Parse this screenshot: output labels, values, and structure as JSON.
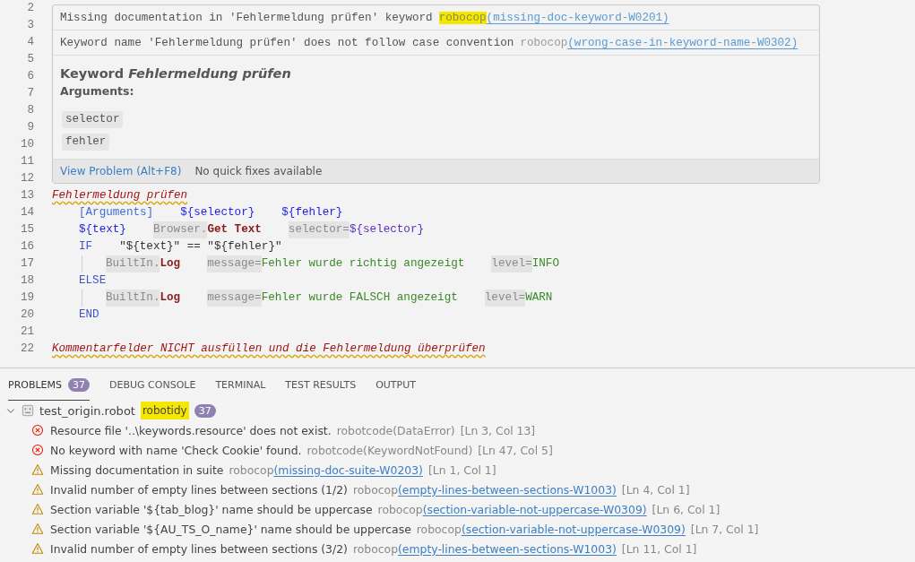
{
  "editor": {
    "lines": [
      {
        "number": "2",
        "kind": "hidden"
      },
      {
        "number": "3",
        "kind": "hidden"
      },
      {
        "number": "4",
        "kind": "hidden"
      },
      {
        "number": "5",
        "kind": "hidden"
      },
      {
        "number": "6",
        "kind": "hidden"
      },
      {
        "number": "7",
        "kind": "hidden"
      },
      {
        "number": "8",
        "kind": "hidden"
      },
      {
        "number": "9",
        "kind": "hidden"
      },
      {
        "number": "10",
        "kind": "hidden"
      },
      {
        "number": "11",
        "kind": "hidden"
      },
      {
        "number": "12",
        "kind": "hidden"
      },
      {
        "number": "13",
        "kind": "keyword",
        "tokens": [
          {
            "kind": "keyword-name",
            "text": "Fehlermeldung prüfen",
            "squiggle": true
          }
        ]
      },
      {
        "number": "14",
        "kind": "step",
        "tokens": [
          {
            "kind": "setting",
            "text": "[Arguments]"
          },
          {
            "kind": "variable",
            "text": "${selector}"
          },
          {
            "kind": "variable",
            "text": "${fehler}"
          }
        ]
      },
      {
        "number": "15",
        "kind": "step",
        "tokens": [
          {
            "kind": "variable",
            "text": "${text}"
          },
          {
            "kind": "call",
            "prefix": "Browser.",
            "text": "Get Text"
          },
          {
            "kind": "variable",
            "prefix": "selector=",
            "text": "${selector}"
          }
        ]
      },
      {
        "number": "16",
        "kind": "step",
        "tokens": [
          {
            "kind": "control",
            "text": "IF"
          },
          {
            "kind": "expression",
            "text": "\"${text}\" == \"${fehler}\""
          }
        ]
      },
      {
        "number": "17",
        "kind": "nested",
        "tokens": [
          {
            "kind": "call",
            "prefix": "BuiltIn.",
            "text": "Log"
          },
          {
            "kind": "string",
            "prefix": "message=",
            "text": "Fehler wurde richtig angezeigt"
          },
          {
            "kind": "string",
            "prefix": "level=",
            "text": "INFO"
          }
        ]
      },
      {
        "number": "18",
        "kind": "step",
        "tokens": [
          {
            "kind": "control",
            "text": "ELSE"
          }
        ]
      },
      {
        "number": "19",
        "kind": "nested",
        "tokens": [
          {
            "kind": "call",
            "prefix": "BuiltIn.",
            "text": "Log"
          },
          {
            "kind": "string",
            "prefix": "message=",
            "text": "Fehler wurde FALSCH angezeigt"
          },
          {
            "kind": "string",
            "prefix": "level=",
            "text": "WARN"
          }
        ]
      },
      {
        "number": "20",
        "kind": "step",
        "tokens": [
          {
            "kind": "control",
            "text": "END"
          }
        ]
      },
      {
        "number": "21",
        "kind": "blank"
      },
      {
        "number": "22",
        "kind": "keyword",
        "tokens": [
          {
            "kind": "keyword-name",
            "text": "Kommentarfelder NICHT ausfüllen und die Fehlermeldung überprüfen",
            "squiggle": true
          }
        ]
      }
    ],
    "hover": {
      "problems": [
        {
          "message": "Missing documentation in 'Fehlermeldung prüfen' keyword",
          "source": "robocop",
          "highlighted": true,
          "code": "(missing-doc-keyword-W0201)"
        },
        {
          "message": "Keyword name 'Fehlermeldung prüfen' does not follow case convention",
          "source": "robocop",
          "highlighted": false,
          "code": "(wrong-case-in-keyword-name-W0302)"
        }
      ],
      "doc_title": "Keyword *Fehlermeldung prüfen*",
      "arguments_label": "Arguments:",
      "arguments": [
        "selector",
        "fehler"
      ],
      "actions": [
        {
          "kind": "link",
          "text": "View Problem (Alt+F8)"
        },
        {
          "kind": "note",
          "text": "No quick fixes available"
        }
      ]
    }
  },
  "panel": {
    "tabs": [
      {
        "label": "PROBLEMS",
        "selected": true,
        "badge": "37"
      },
      {
        "label": "DEBUG CONSOLE",
        "selected": false
      },
      {
        "label": "TERMINAL",
        "selected": false
      },
      {
        "label": "TEST RESULTS",
        "selected": false
      },
      {
        "label": "OUTPUT",
        "selected": false
      }
    ],
    "file": {
      "name": "test_origin.robot",
      "expanded": true,
      "tag": "robotidy",
      "tag_highlighted": true,
      "count": "37",
      "problems": [
        {
          "kind": "error",
          "message": "Resource file '..\\keywords.resource' does not exist.",
          "source": "robotcode",
          "code": "(DataError)",
          "linked": false,
          "location": "[Ln 3, Col 13]"
        },
        {
          "kind": "error",
          "message": "No keyword with name 'Check Cookie' found.",
          "source": "robotcode",
          "code": "(KeywordNotFound)",
          "linked": false,
          "location": "[Ln 47, Col 5]"
        },
        {
          "kind": "warning",
          "message": "Missing documentation in suite",
          "source": "robocop",
          "code": "(missing-doc-suite-W0203)",
          "linked": true,
          "location": "[Ln 1, Col 1]"
        },
        {
          "kind": "warning",
          "message": "Invalid number of empty lines between sections (1/2)",
          "source": "robocop",
          "code": "(empty-lines-between-sections-W1003)",
          "linked": true,
          "location": "[Ln 4, Col 1]"
        },
        {
          "kind": "warning",
          "message": "Section variable '${tab_blog}' name should be uppercase",
          "source": "robocop",
          "code": "(section-variable-not-uppercase-W0309)",
          "linked": true,
          "location": "[Ln 6, Col 1]"
        },
        {
          "kind": "warning",
          "message": "Section variable '${AU_TS_O_name}' name should be uppercase",
          "source": "robocop",
          "code": "(section-variable-not-uppercase-W0309)",
          "linked": true,
          "location": "[Ln 7, Col 1]"
        },
        {
          "kind": "warning",
          "message": "Invalid number of empty lines between sections (3/2)",
          "source": "robocop",
          "code": "(empty-lines-between-sections-W1003)",
          "linked": true,
          "location": "[Ln 11, Col 1]"
        }
      ]
    }
  }
}
